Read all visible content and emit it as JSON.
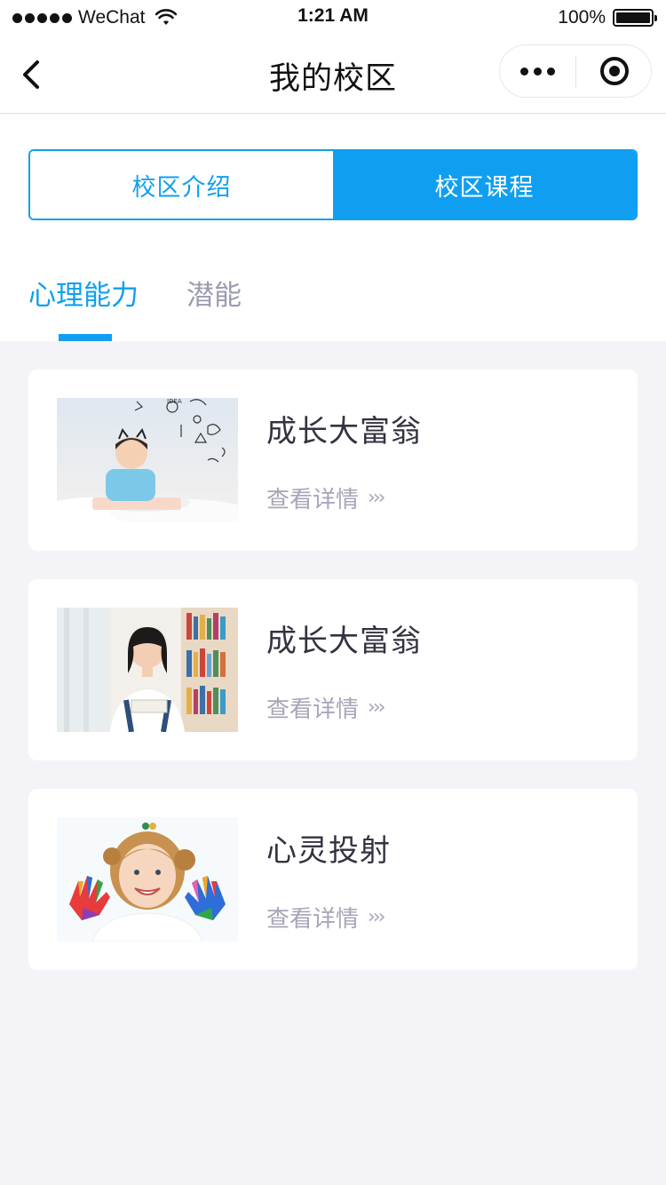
{
  "status_bar": {
    "carrier": "WeChat",
    "time": "1:21 AM",
    "battery": "100%",
    "battery_level": 1.0
  },
  "nav": {
    "title": "我的校区"
  },
  "segment": {
    "left_label": "校区介绍",
    "right_label": "校区课程",
    "active": "right"
  },
  "tabs": [
    {
      "label": "心理能力",
      "active": true
    },
    {
      "label": "潜能",
      "active": false
    }
  ],
  "cards": [
    {
      "title": "成长大富翁",
      "link_label": "查看详情",
      "image": "boy-drawing-on-clouds"
    },
    {
      "title": "成长大富翁",
      "link_label": "查看详情",
      "image": "girl-in-library"
    },
    {
      "title": "心灵投射",
      "link_label": "查看详情",
      "image": "girl-painted-hands"
    }
  ],
  "colors": {
    "accent": "#109ff0",
    "background": "#f4f4f8",
    "muted_text": "#a6a6b8"
  }
}
